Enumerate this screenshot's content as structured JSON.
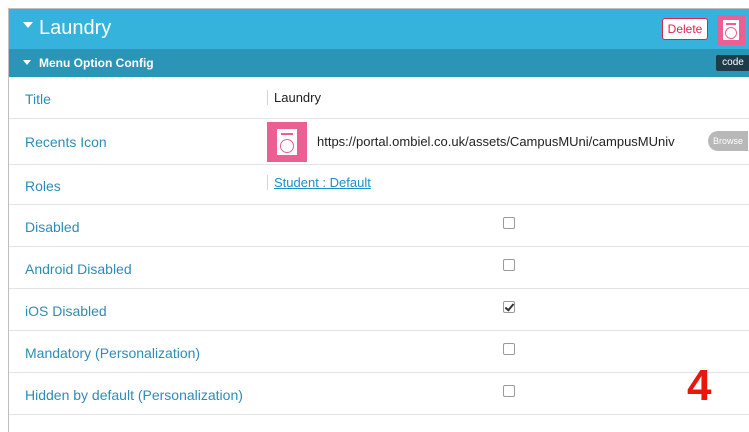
{
  "header": {
    "title": "Laundry",
    "delete_label": "Delete",
    "icon": "washing-machine-icon",
    "color": "#36b3dd"
  },
  "subheader": {
    "label": "Menu Option Config",
    "code_label": "code",
    "color": "#2a95b6"
  },
  "fields": {
    "title": {
      "label": "Title",
      "value": "Laundry"
    },
    "recents_icon": {
      "label": "Recents Icon",
      "icon": "washing-machine-icon",
      "url": "https://portal.ombiel.co.uk/assets/CampusMUni/campusMUniv",
      "browse_label": "Browse"
    },
    "roles": {
      "label": "Roles",
      "value": "Student : Default"
    },
    "disabled": {
      "label": "Disabled",
      "checked": false
    },
    "android_disabled": {
      "label": "Android Disabled",
      "checked": false
    },
    "ios_disabled": {
      "label": "iOS Disabled",
      "checked": true
    },
    "mandatory": {
      "label": "Mandatory (Personalization)",
      "checked": false
    },
    "hidden_by_default": {
      "label": "Hidden by default (Personalization)",
      "checked": false
    }
  },
  "annotation": {
    "step": "4",
    "color": "#e8170e"
  },
  "accent_color": "#ec5f93"
}
